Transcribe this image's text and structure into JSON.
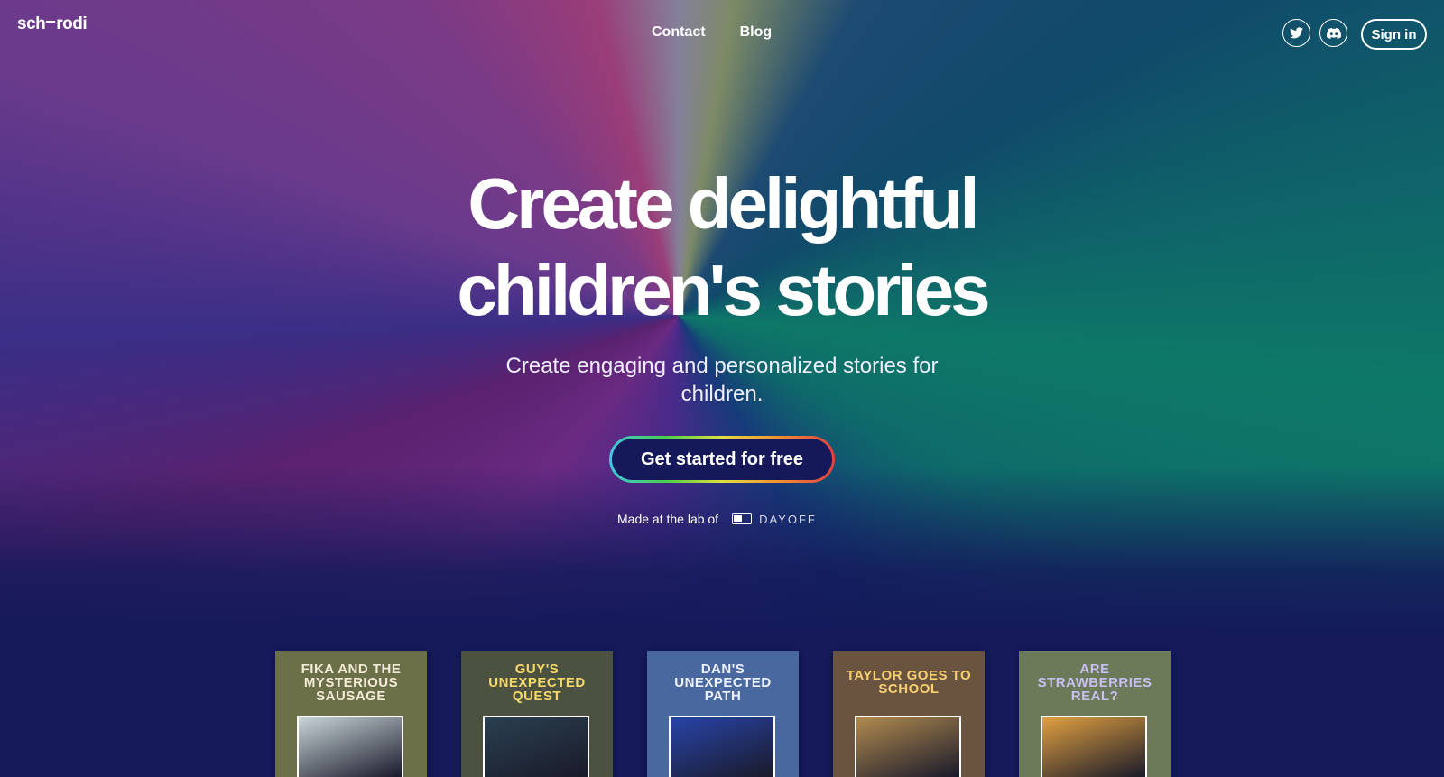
{
  "header": {
    "logo": {
      "left": "sch",
      "right": "rodi"
    },
    "nav": [
      {
        "label": "Contact"
      },
      {
        "label": "Blog"
      }
    ],
    "signin_label": "Sign in"
  },
  "hero": {
    "title_line1": "Create delightful",
    "title_line2": "children's stories",
    "subtitle": "Create engaging and personalized stories for children.",
    "cta_label": "Get started for free",
    "made_label": "Made at the lab of",
    "lab_name": "DAYOFF"
  },
  "books": [
    {
      "title": "FIKA AND THE MYSTERIOUS SAUSAGE",
      "bg": "#6b7048",
      "title_color": "#f3ead8",
      "art": "#c8d4d8"
    },
    {
      "title": "GUY'S UNEXPECTED QUEST",
      "bg": "#4c5240",
      "title_color": "#f5d86a",
      "art": "#2a4050"
    },
    {
      "title": "DAN'S UNEXPECTED PATH",
      "bg": "#4a68a0",
      "title_color": "#eef2ff",
      "art": "#2844a8"
    },
    {
      "title": "TAYLOR GOES TO SCHOOL",
      "bg": "#6a5440",
      "title_color": "#f7d070",
      "art": "#b08a50"
    },
    {
      "title": "ARE STRAWBERRIES REAL?",
      "bg": "#6c7a5a",
      "title_color": "#c8c0f0",
      "art": "#e0a040"
    }
  ]
}
